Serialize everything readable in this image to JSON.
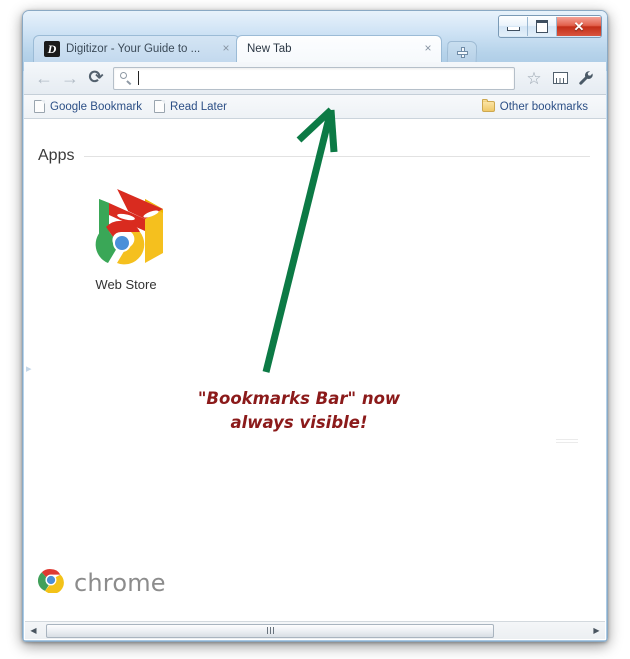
{
  "window": {
    "controls": {
      "minimize_label": "Minimize",
      "maximize_label": "Maximize",
      "close_label": "✕"
    }
  },
  "tabs": [
    {
      "title": "Digitizor - Your Guide to ...",
      "favicon": "D",
      "close_label": "×",
      "active": false
    },
    {
      "title": "New Tab",
      "favicon": "",
      "close_label": "×",
      "active": true
    }
  ],
  "newtab_button": {
    "name": "new-tab-button",
    "glyph": "+"
  },
  "toolbar": {
    "back_glyph": "←",
    "forward_glyph": "→",
    "reload_glyph": "⟳",
    "omnibox": {
      "value": "",
      "placeholder": ""
    },
    "star_glyph": "☆",
    "page_menu_label": "Page menu",
    "wrench_label": "Customize and control Google Chrome"
  },
  "bookmarks_bar": {
    "items": [
      {
        "label": "Google Bookmark",
        "icon": "document-icon"
      },
      {
        "label": "Read Later",
        "icon": "document-icon"
      }
    ],
    "other": {
      "label": "Other bookmarks",
      "icon": "folder-icon"
    }
  },
  "newtab_page": {
    "apps_heading": "Apps",
    "apps": [
      {
        "label": "Web Store",
        "icon": "web-store-icon"
      }
    ],
    "brand_word": "chrome",
    "edge_hint_glyph": "▸"
  },
  "annotation": {
    "text": "\"Bookmarks Bar\" now\nalways visible!",
    "text_color": "#8b1a1a",
    "arrow_color": "#0c7a45"
  },
  "scrollbar": {
    "left_arrow_glyph": "◀",
    "right_arrow_glyph": "▶"
  },
  "colors": {
    "frame_blue": "#a9c9e4",
    "tab_active": "#fdfeff",
    "bookmark_link": "#2c4f86",
    "close_red": "#c32e18",
    "annotation_red": "#8b1a1a",
    "arrow_green": "#0c7a45"
  }
}
